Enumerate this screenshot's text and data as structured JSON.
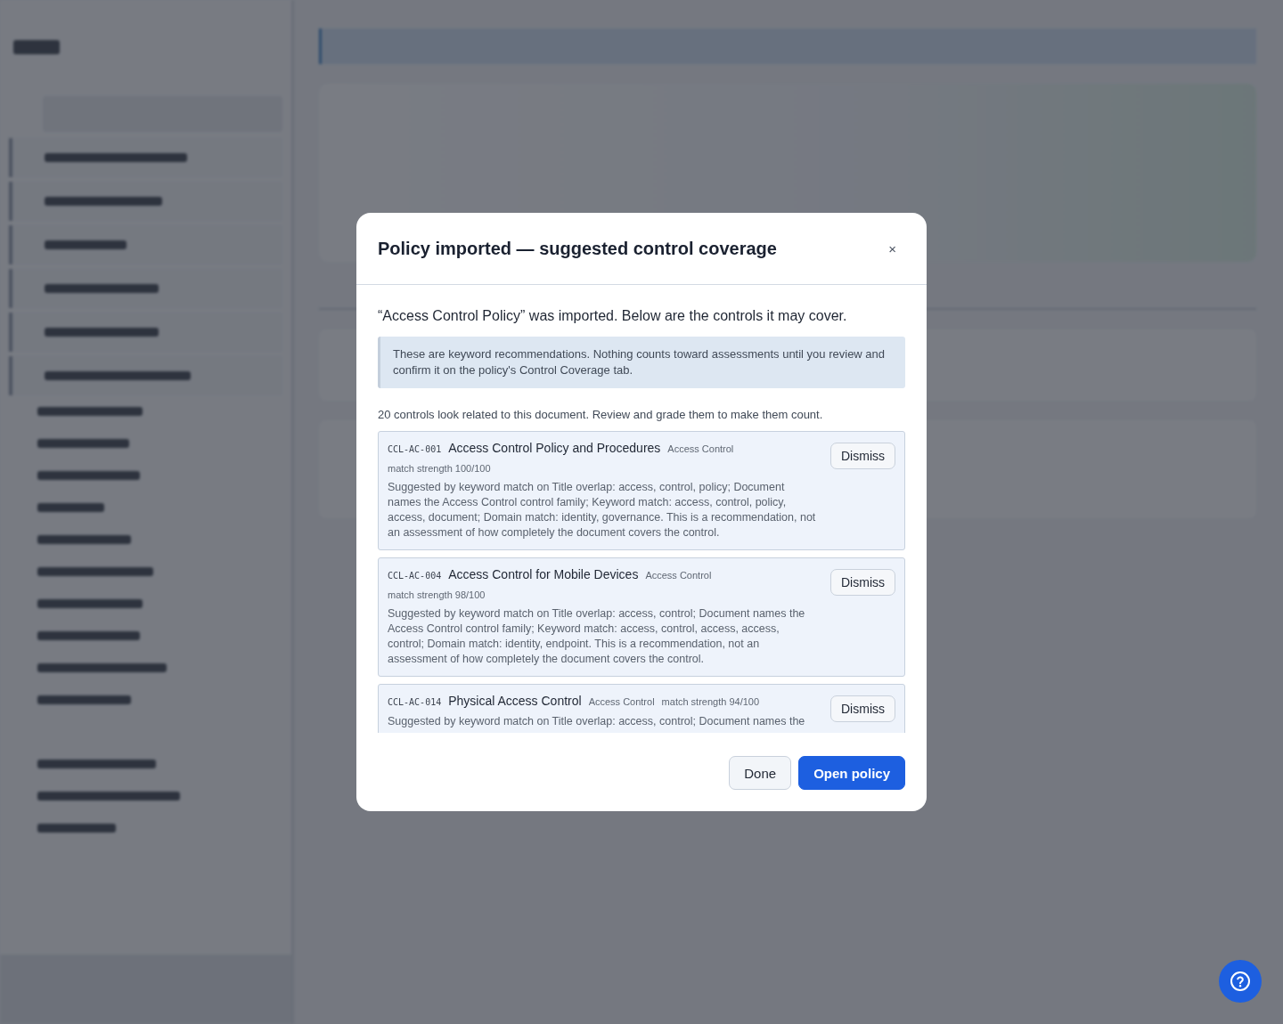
{
  "modal": {
    "title": "Policy imported — suggested control coverage",
    "close": "×",
    "intro": "“Access Control Policy” was imported. Below are the controls it may cover.",
    "notice": "These are keyword recommendations. Nothing counts toward assessments until you review and confirm it on the policy's Control Coverage tab.",
    "summary": "20 controls look related to this document. Review and grade them to make them count.",
    "suggestions": [
      {
        "code": "CCL-AC-001",
        "title": "Access Control Policy and Procedures",
        "family": "Access Control",
        "strength": "match strength 100/100",
        "reason": "Suggested by keyword match on Title overlap: access, control, policy; Document names the Access Control control family; Keyword match: access, control, policy, access, document; Domain match: identity, governance. This is a recommendation, not an assessment of how completely the document covers the control.",
        "action": "Dismiss"
      },
      {
        "code": "CCL-AC-004",
        "title": "Access Control for Mobile Devices",
        "family": "Access Control",
        "strength": "match strength 98/100",
        "reason": "Suggested by keyword match on Title overlap: access, control; Document names the Access Control control family; Keyword match: access, control, access, access, control; Domain match: identity, endpoint. This is a recommendation, not an assessment of how completely the document covers the control.",
        "action": "Dismiss"
      },
      {
        "code": "CCL-AC-014",
        "title": "Physical Access Control",
        "family": "Access Control",
        "strength": "match strength 94/100",
        "reason": "Suggested by keyword match on Title overlap: access, control; Document names the",
        "action": "Dismiss"
      }
    ],
    "buttons": [
      {
        "label": "Done",
        "kind": "secondary"
      },
      {
        "label": "Open policy",
        "kind": "primary"
      }
    ]
  }
}
